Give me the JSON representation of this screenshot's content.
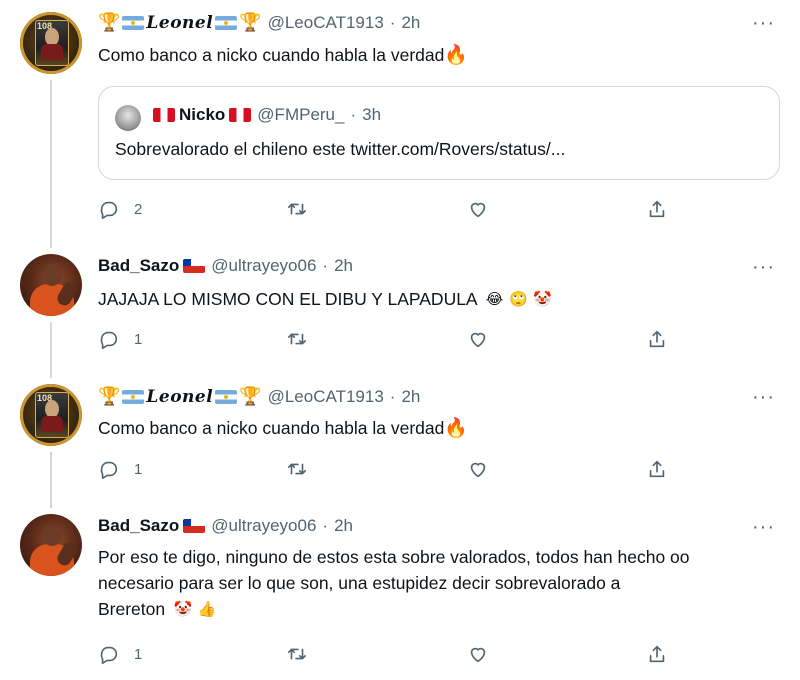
{
  "tweets": [
    {
      "name": "Leonel",
      "handle": "@LeoCAT1913",
      "time": "2h",
      "text": "Como banco a nicko cuando habla la verdad",
      "reply_count": "2",
      "quote": {
        "name": "Nicko",
        "handle": "@FMPeru_",
        "time": "3h",
        "text": "Sobrevalorado el chileno este twitter.com/Rovers/status/..."
      }
    },
    {
      "name": "Bad_Sazo",
      "handle": "@ultrayeyo06",
      "time": "2h",
      "text": "JAJAJA LO MISMO CON EL DIBU Y LAPADULA",
      "reply_count": "1"
    },
    {
      "name": "Leonel",
      "handle": "@LeoCAT1913",
      "time": "2h",
      "text": "Como banco a nicko cuando habla la verdad",
      "reply_count": "1"
    },
    {
      "name": "Bad_Sazo",
      "handle": "@ultrayeyo06",
      "time": "2h",
      "lines": [
        "Por eso te digo, ninguno de estos esta sobre valorados, todos han hecho oo",
        "necesario para ser lo que son, una estupidez decir sobrevalorado a",
        "Brereton"
      ],
      "reply_count": "1"
    }
  ],
  "ui": {
    "dot": "·",
    "more": "···"
  },
  "icons": [
    "reply-icon",
    "retweet-icon",
    "like-icon",
    "share-icon",
    "more-icon",
    "fire-emoji",
    "trophy-emoji",
    "flag-argentina",
    "flag-chile",
    "flag-peru",
    "crying-laughing-emoji",
    "rolling-eyes-emoji",
    "clown-emoji",
    "thumbs-up-emoji"
  ],
  "colors": {
    "text": "#0f1419",
    "muted": "#536471",
    "border": "#cfd9de",
    "background": "#ffffff"
  }
}
